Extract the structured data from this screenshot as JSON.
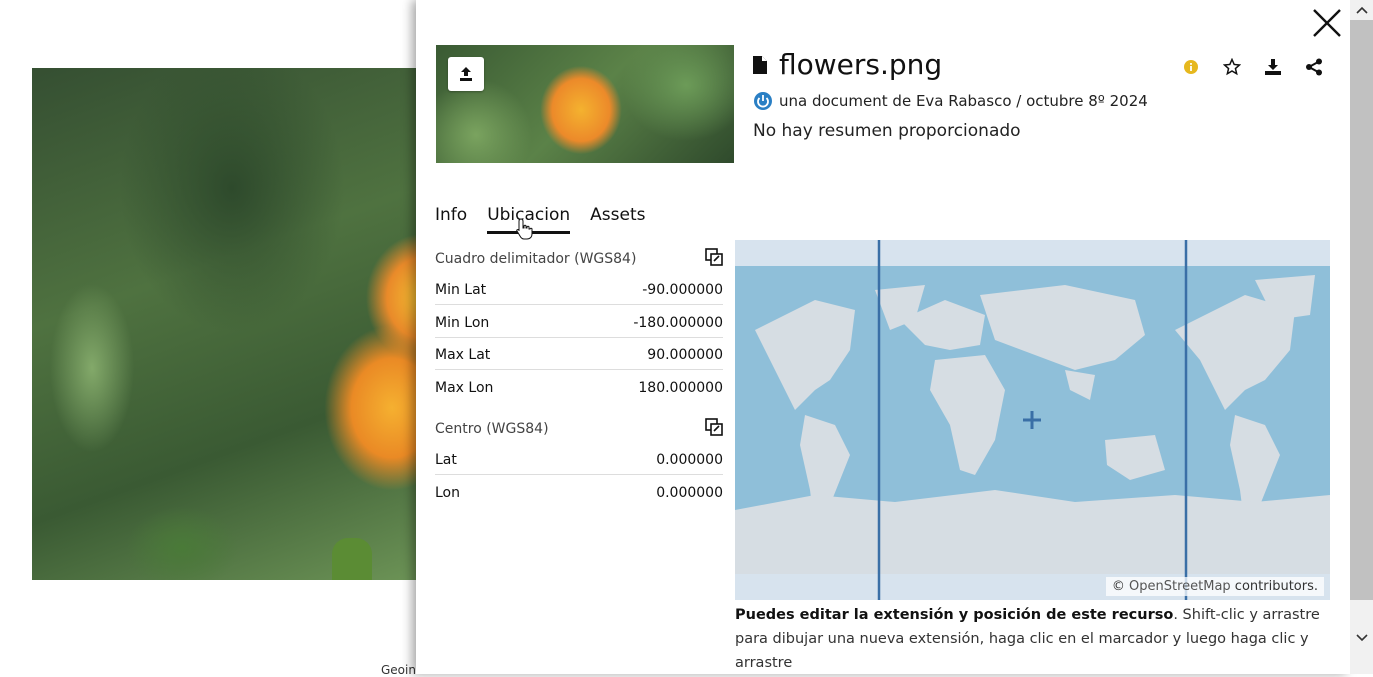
{
  "footer": {
    "org": "Geoinnova"
  },
  "resource": {
    "title": "flowers.png",
    "meta": "una document de Eva Rabasco / octubre 8º 2024",
    "abstract": "No hay resumen proporcionado"
  },
  "tabs": [
    {
      "label": "Info"
    },
    {
      "label": "Ubicacion",
      "active": true
    },
    {
      "label": "Assets"
    }
  ],
  "bbox": {
    "title": "Cuadro delimitador (WGS84)",
    "rows": [
      {
        "label": "Min Lat",
        "value": "-90.000000"
      },
      {
        "label": "Min Lon",
        "value": "-180.000000"
      },
      {
        "label": "Max Lat",
        "value": "90.000000"
      },
      {
        "label": "Max Lon",
        "value": "180.000000"
      }
    ]
  },
  "center": {
    "title": "Centro (WGS84)",
    "rows": [
      {
        "label": "Lat",
        "value": "0.000000"
      },
      {
        "label": "Lon",
        "value": "0.000000"
      }
    ]
  },
  "map": {
    "attribution_link": "OpenStreetMap",
    "attribution_prefix": "© ",
    "attribution_suffix": " contributors."
  },
  "help": {
    "bold": "Puedes editar la extensión y posición de este recurso",
    "rest": ". Shift-clic y arrastre para dibujar una nueva extensión, haga clic en el marcador y luego haga clic y arrastre"
  },
  "colors": {
    "info_badge": "#e6b81e",
    "owner_icon": "#2a7fc4",
    "map_ocean": "#8fbfd9",
    "map_land": "#d6dde3",
    "map_line": "#3a6fa6"
  }
}
